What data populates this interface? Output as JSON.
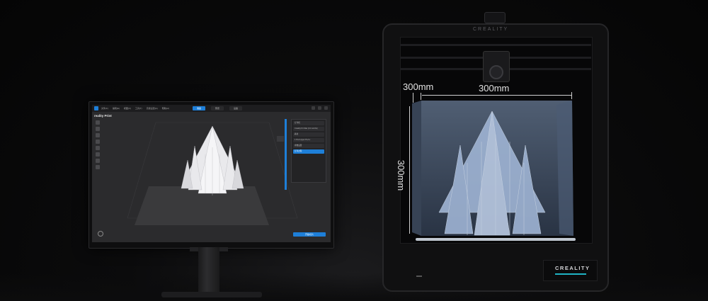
{
  "monitor": {
    "app_title": "reality Print",
    "menu": [
      "文件(F)",
      "编辑(E)",
      "视图(V)",
      "工具(T)",
      "高级设置(A)",
      "帮助(H)"
    ],
    "tabs": [
      {
        "label": "准备",
        "active": true
      },
      {
        "label": "预览",
        "active": false
      },
      {
        "label": "设备",
        "active": false
      }
    ],
    "right_panel": {
      "rows": [
        {
          "label": "打印机",
          "selected": false
        },
        {
          "label": "Creality K1 Max (0.4 nozzle)",
          "selected": false
        },
        {
          "label": "耗材",
          "selected": false
        },
        {
          "label": "1  PLA       Hyper PLA  ▾",
          "selected": false
        },
        {
          "label": "参数设置",
          "selected": false
        },
        {
          "label": "打印过程",
          "selected": true
        }
      ]
    },
    "slice_button": "开始切片"
  },
  "printer": {
    "brand_top": "CREALITY",
    "brand_front": "CREALITY",
    "accent_color": "#1fb3c4"
  },
  "dimensions": {
    "depth_label": "300mm",
    "width_label": "300mm",
    "height_label": "300mm"
  }
}
